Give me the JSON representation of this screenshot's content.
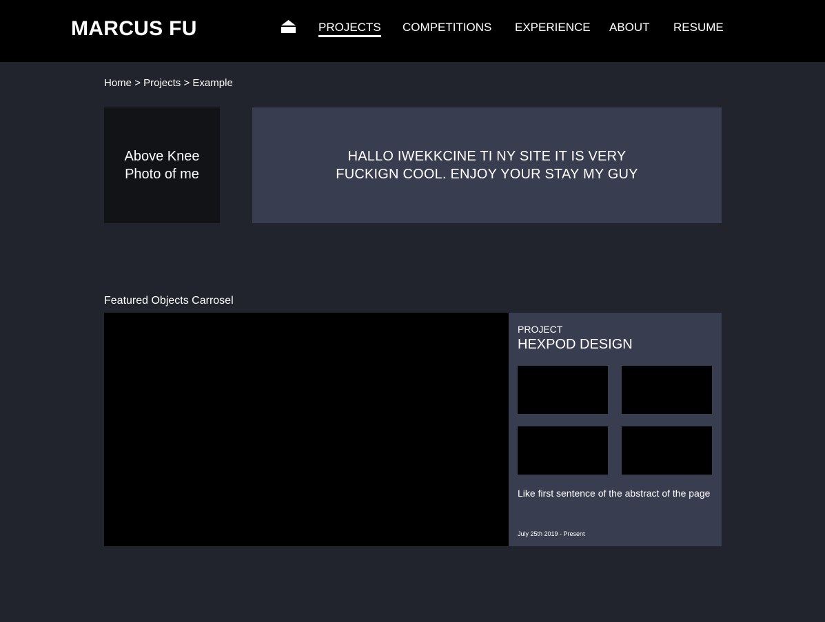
{
  "header": {
    "brand": "MARCUS FU",
    "home_icon": "home-icon",
    "nav": [
      {
        "label": "PROJECTS",
        "active": true
      },
      {
        "label": "COMPETITIONS",
        "active": false
      },
      {
        "label": "EXPERIENCE",
        "active": false
      },
      {
        "label": "ABOUT",
        "active": false
      },
      {
        "label": "RESUME",
        "active": false
      }
    ]
  },
  "breadcrumb": {
    "items": [
      "Home",
      "Projects",
      "Example"
    ],
    "separator": ">"
  },
  "intro": {
    "photo_placeholder": "Above Knee Photo of me",
    "greeting": "HALLO IWEKKCINE TI NY SITE IT IS VERY FUCKIGN COOL. ENJOY YOUR STAY MY GUY"
  },
  "featured": {
    "title": "Featured Objects Carrosel",
    "project": {
      "kicker": "PROJECT",
      "name": "HEXPOD DESIGN",
      "description": "Like first sentence of the abstract of the page",
      "dates": "July 25th 2019 - Present"
    }
  },
  "colors": {
    "background": "#21242d",
    "header": "#000000",
    "panel": "#393d50",
    "photo_box": "#111317",
    "text": "#ffffff"
  }
}
